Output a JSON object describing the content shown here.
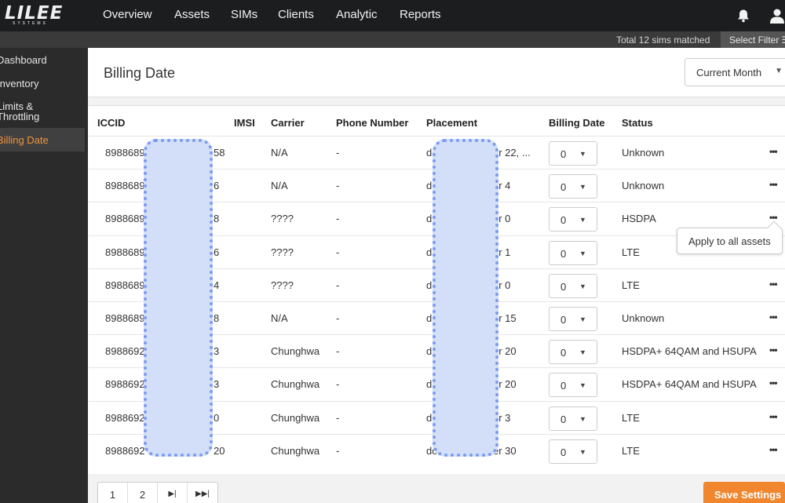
{
  "brand": {
    "name": "LILEE",
    "sub": "SYSTEMS"
  },
  "nav": [
    "Overview",
    "Assets",
    "SIMs",
    "Clients",
    "Analytic",
    "Reports"
  ],
  "filter": {
    "matched": "Total 12 sims matched",
    "select_filter": "Select Filter ☰"
  },
  "sidebar": [
    "Dashboard",
    "Inventory",
    "Limits & Throttling",
    "Billing Date"
  ],
  "page_title": "Billing Date",
  "period_select": "Current Month",
  "columns": [
    "ICCID",
    "IMSI",
    "Carrier",
    "Phone Number",
    "Placement",
    "Billing Date",
    "Status"
  ],
  "rows": [
    {
      "iccid_start": "8988689",
      "iccid_end": "58",
      "carrier": "N/A",
      "phone": "-",
      "placement_start": "do",
      "placement_end": "er 22, ...",
      "billing": "0",
      "status": "Unknown"
    },
    {
      "iccid_start": "8988689",
      "iccid_end": "6",
      "carrier": "N/A",
      "phone": "-",
      "placement_start": "d",
      "placement_end": "er 4",
      "billing": "0",
      "status": "Unknown"
    },
    {
      "iccid_start": "8988689",
      "iccid_end": "8",
      "carrier": "????",
      "phone": "-",
      "placement_start": "d",
      "placement_end": "er 0",
      "billing": "0",
      "status": "HSDPA"
    },
    {
      "iccid_start": "8988689",
      "iccid_end": "6",
      "carrier": "????",
      "phone": "-",
      "placement_start": "d",
      "placement_end": "er 1",
      "billing": "0",
      "status": "LTE"
    },
    {
      "iccid_start": "8988689",
      "iccid_end": "4",
      "carrier": "????",
      "phone": "-",
      "placement_start": "d",
      "placement_end": "er 0",
      "billing": "0",
      "status": "LTE"
    },
    {
      "iccid_start": "8988689",
      "iccid_end": "8",
      "carrier": "N/A",
      "phone": "-",
      "placement_start": "d",
      "placement_end": "er 15",
      "billing": "0",
      "status": "Unknown"
    },
    {
      "iccid_start": "8988692",
      "iccid_end": "3",
      "carrier": "Chunghwa",
      "phone": "-",
      "placement_start": "d",
      "placement_end": "er 20",
      "billing": "0",
      "status": "HSDPA+ 64QAM and HSUPA"
    },
    {
      "iccid_start": "8988692",
      "iccid_end": "3",
      "carrier": "Chunghwa",
      "phone": "-",
      "placement_start": "d",
      "placement_end": "er 20",
      "billing": "0",
      "status": "HSDPA+ 64QAM and HSUPA"
    },
    {
      "iccid_start": "8988692",
      "iccid_end": "0",
      "carrier": "Chunghwa",
      "phone": "-",
      "placement_start": "d",
      "placement_end": "er 3",
      "billing": "0",
      "status": "LTE"
    },
    {
      "iccid_start": "8988692",
      "iccid_end": "20",
      "carrier": "Chunghwa",
      "phone": "-",
      "placement_start": "do",
      "placement_end": "er 30",
      "billing": "0",
      "status": "LTE"
    }
  ],
  "more_label": "•••",
  "caret": "▼",
  "tooltip": "Apply to all assets",
  "pager": [
    "1",
    "2",
    "▶|",
    "▶▶|"
  ],
  "save_label": "Save Settings"
}
